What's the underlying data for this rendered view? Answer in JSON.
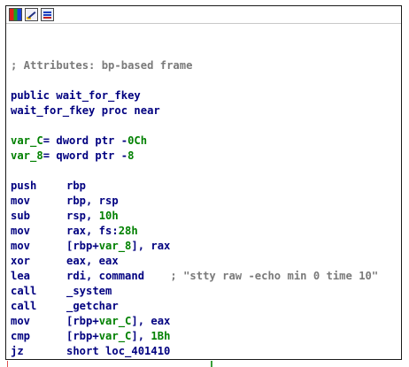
{
  "toolbar": {
    "icons": [
      "color-palette-icon",
      "rename-edit-icon",
      "graph-overview-icon"
    ]
  },
  "listing": {
    "attributes_comment": "; Attributes: bp-based frame",
    "public_decl": "public wait_for_fkey",
    "proc_decl": "wait_for_fkey proc near",
    "var_c_name": "var_C",
    "var_c_def": "= dword ptr -",
    "var_c_off": "0Ch",
    "var_8_name": "var_8",
    "var_8_def": "= qword ptr -",
    "var_8_off": "8",
    "instructions": [
      {
        "mnem": "push",
        "ops": "rbp"
      },
      {
        "mnem": "mov",
        "ops": "rbp, rsp"
      },
      {
        "mnem": "sub",
        "ops_pre": "rsp, ",
        "imm": "10h"
      },
      {
        "mnem": "mov",
        "ops_pre": "rax, fs:",
        "imm": "28h"
      },
      {
        "mnem": "mov",
        "ops_pre": "[rbp+",
        "var": "var_8",
        "ops_post": "], rax"
      },
      {
        "mnem": "xor",
        "ops": "eax, eax"
      },
      {
        "mnem": "lea",
        "ops": "rdi, command",
        "comment": "    ; \"stty raw -echo min 0 time 10\""
      },
      {
        "mnem": "call",
        "ops": "_system"
      },
      {
        "mnem": "call",
        "ops": "_getchar"
      },
      {
        "mnem": "mov",
        "ops_pre": "[rbp+",
        "var": "var_C",
        "ops_post": "], eax"
      },
      {
        "mnem": "cmp",
        "ops_pre": "[rbp+",
        "var": "var_C",
        "ops_post": "], ",
        "imm": "1Bh"
      },
      {
        "mnem": "jz",
        "ops": "short loc_401410"
      }
    ]
  },
  "colors": {
    "code": "#000080",
    "comment": "#7a7a7a",
    "variable": "#008000",
    "edge_true": "#3aa03a",
    "edge_false": "#e05050"
  }
}
